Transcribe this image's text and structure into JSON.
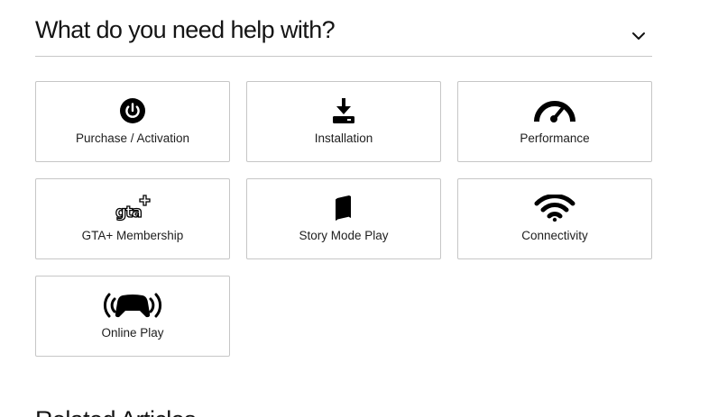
{
  "help": {
    "title": "What do you need help with?",
    "toggle_icon": "chevron-down-icon"
  },
  "categories": [
    {
      "label": "Purchase / Activation",
      "icon": "power-icon"
    },
    {
      "label": "Installation",
      "icon": "download-icon"
    },
    {
      "label": "Performance",
      "icon": "speedometer-icon"
    },
    {
      "label": "GTA+ Membership",
      "icon": "gta-plus-icon"
    },
    {
      "label": "Story Mode Play",
      "icon": "book-icon"
    },
    {
      "label": "Connectivity",
      "icon": "wifi-icon"
    },
    {
      "label": "Online Play",
      "icon": "wireless-controller-icon"
    }
  ],
  "next_section": {
    "title_partial": "Related Articles"
  },
  "colors": {
    "text": "#141414",
    "border": "#c6c6c6",
    "divider": "#c8c8c8",
    "background": "#ffffff"
  }
}
